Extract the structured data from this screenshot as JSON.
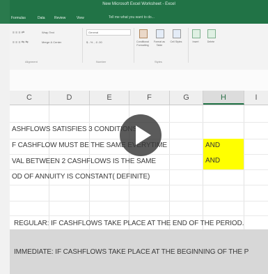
{
  "window": {
    "title": "New Microsoft Excel Worksheet - Excel"
  },
  "ribbon": {
    "tabs": [
      "Formulas",
      "Data",
      "Review",
      "View"
    ],
    "tell_me": "Tell me what you want to do...",
    "wrap_text": "Wrap Text",
    "merge_center": "Merge & Center",
    "number_format": "General",
    "number_symbols": "$ - % , .0 .00",
    "conditional_formatting": "Conditional Formatting",
    "format_as_table": "Format as Table",
    "cell_styles": "Cell Styles",
    "insert": "Insert",
    "delete": "Delete",
    "groups": {
      "alignment": "Alignment",
      "number": "Number",
      "styles": "Styles"
    }
  },
  "columns": [
    "C",
    "D",
    "E",
    "F",
    "G",
    "H",
    "I"
  ],
  "selected_column": "H",
  "rows": [
    {
      "text": "ASHFLOWS SATISFIES 3 CONDITIONS"
    },
    {
      "text": "F CASHFLOW MUST BE THE SAME EVERYTIME",
      "h_value": "AND"
    },
    {
      "text": "VAL BETWEEN 2 CASHFLOWS IS THE SAME",
      "h_value": "AND"
    },
    {
      "text": "OD OF ANNUITY IS CONSTANT( DEFINITE)"
    },
    {
      "text": "REGULAR: IF CASHFLOWS TAKE PLACE AT THE END OF THE PERIOD."
    },
    {
      "text": "IMMEDIATE: IF CASHFLOWS TAKE PLACE AT THE BEGINNING OF THE P"
    }
  ],
  "colors": {
    "excel_green": "#217346",
    "highlight": "#ffff00",
    "play_overlay": "#373737"
  }
}
